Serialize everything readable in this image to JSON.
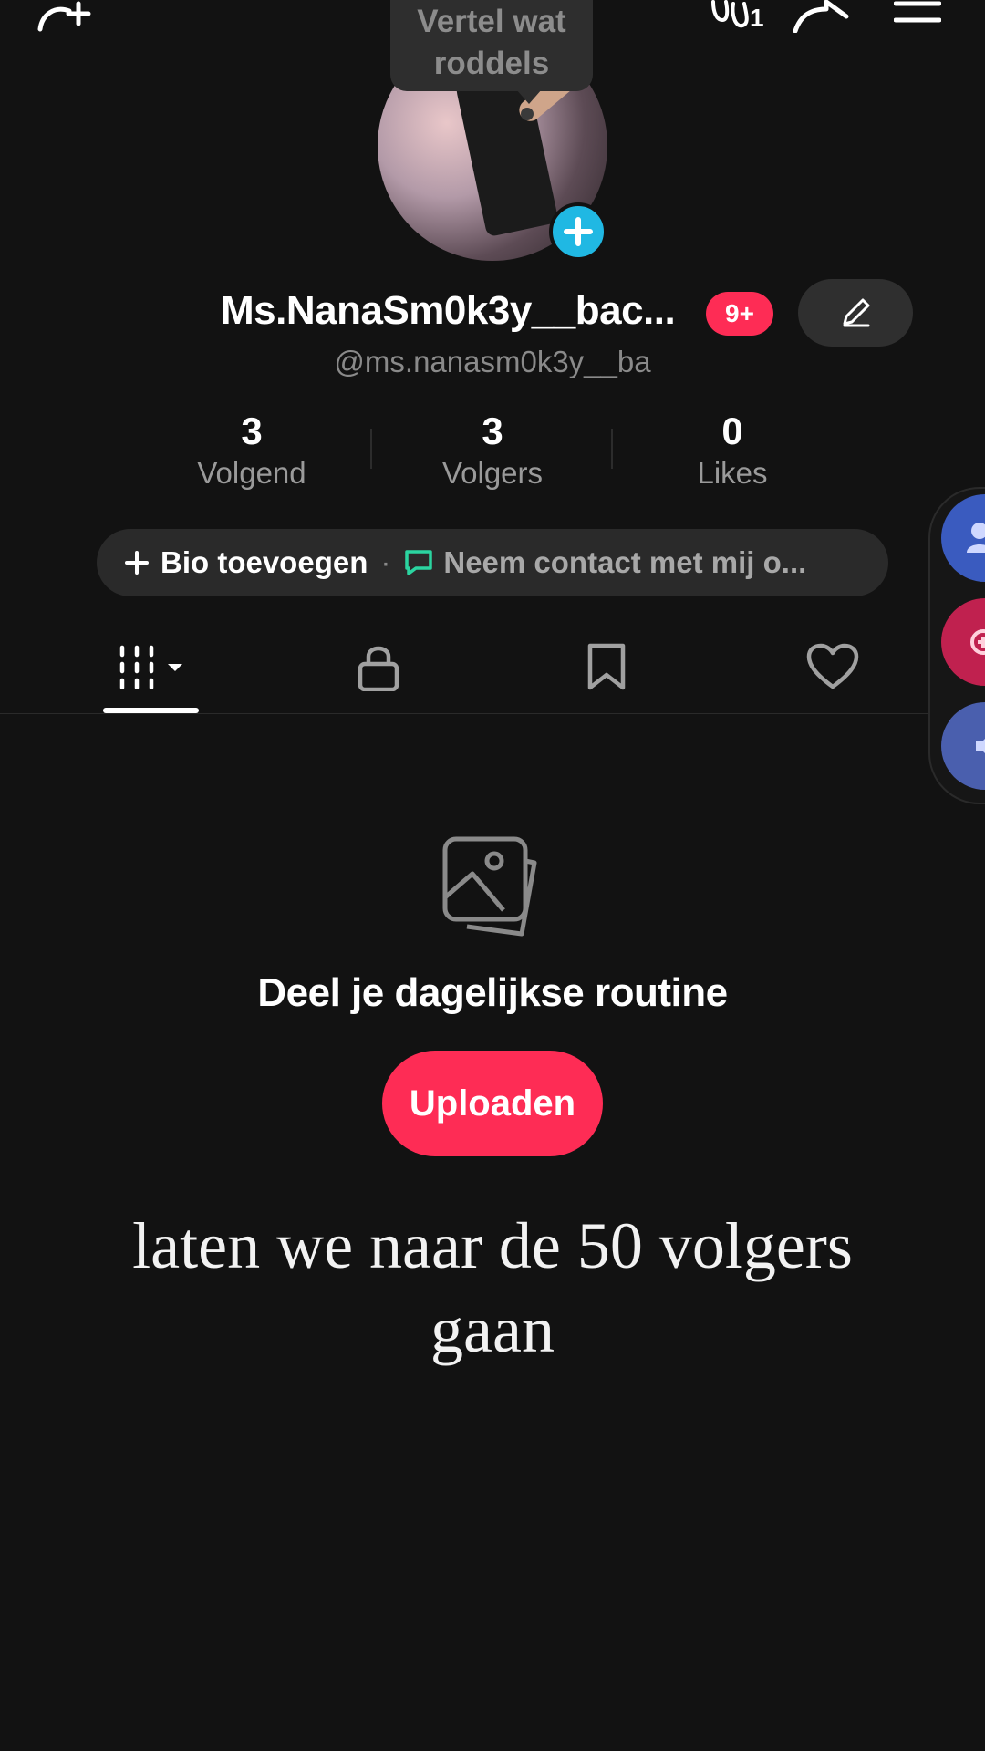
{
  "colors": {
    "background": "#121212",
    "accent_red": "#fe2c55",
    "accent_blue": "#20b8e3",
    "chat_green": "#2bd4a0"
  },
  "top_bar": {
    "add_friend_icon": "add-friend-icon",
    "footprint_icon": "footprint-icon",
    "footprint_count": "1",
    "share_icon": "share-icon",
    "menu_icon": "menu-icon"
  },
  "bubble": {
    "line1": "Vertel wat",
    "line2": "roddels"
  },
  "profile": {
    "display_name": "Ms.NanaSm0k3y__bac...",
    "notification_badge": "9+",
    "username": "@ms.nanasm0k3y__ba"
  },
  "stats": [
    {
      "value": "3",
      "label": "Volgend"
    },
    {
      "value": "3",
      "label": "Volgers"
    },
    {
      "value": "0",
      "label": "Likes"
    }
  ],
  "bio": {
    "add_label": "Bio toevoegen",
    "separator": "·",
    "contact_label": "Neem contact met mij o..."
  },
  "tabs": [
    {
      "name": "videos",
      "icon": "grid-icon",
      "active": true
    },
    {
      "name": "private",
      "icon": "lock-icon",
      "active": false
    },
    {
      "name": "saved",
      "icon": "bookmark-icon",
      "active": false
    },
    {
      "name": "liked",
      "icon": "heart-icon",
      "active": false
    }
  ],
  "side_panel": {
    "colors": [
      "#3a5bbf",
      "#c0214f",
      "#4a5fae"
    ]
  },
  "empty_state": {
    "icon": "photos-icon",
    "title": "Deel je dagelijkse routine",
    "upload_label": "Uploaden"
  },
  "caption": {
    "line1": "laten we naar de 50 volgers",
    "line2": "gaan"
  }
}
